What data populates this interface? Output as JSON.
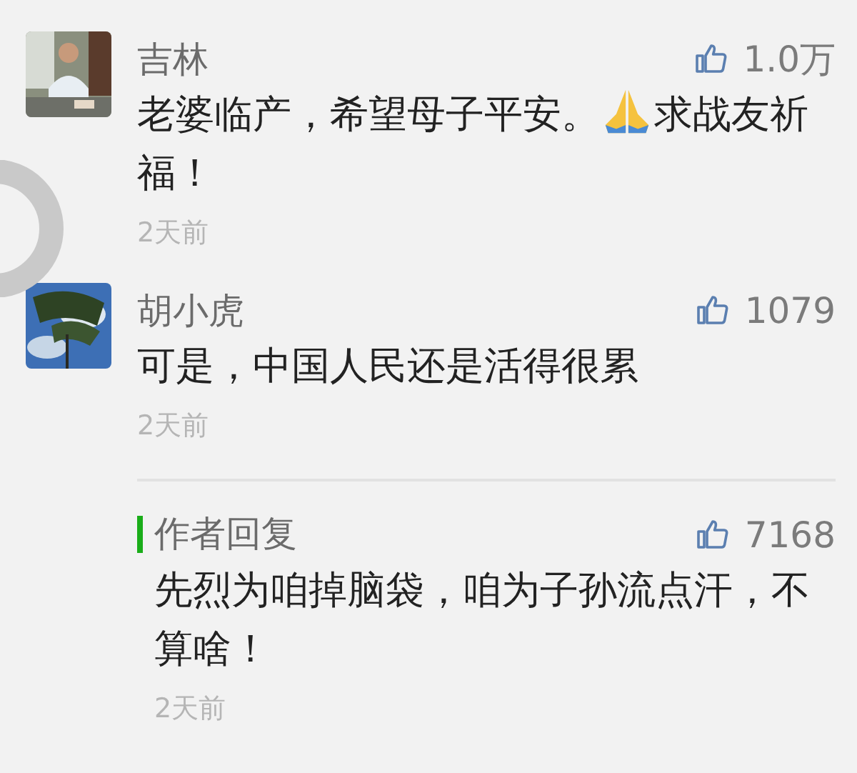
{
  "comments": [
    {
      "name": "吉林",
      "likes": "1.0万",
      "text_parts": [
        "老婆临产，希望母子平安。",
        "求战友祈",
        "福！"
      ],
      "time": "2天前",
      "avatar": {
        "kind": "picture"
      }
    },
    {
      "name": "胡小虎",
      "likes": "1079",
      "text_parts": [
        "可是，中国人民还是活得很累"
      ],
      "time": "2天前",
      "avatar": {
        "kind": "picture"
      },
      "reply": {
        "label": "作者回复",
        "likes": "7168",
        "text": "先烈为咱掉脑袋，咱为子孙流点汗，不算啥！",
        "time": "2天前"
      }
    }
  ]
}
